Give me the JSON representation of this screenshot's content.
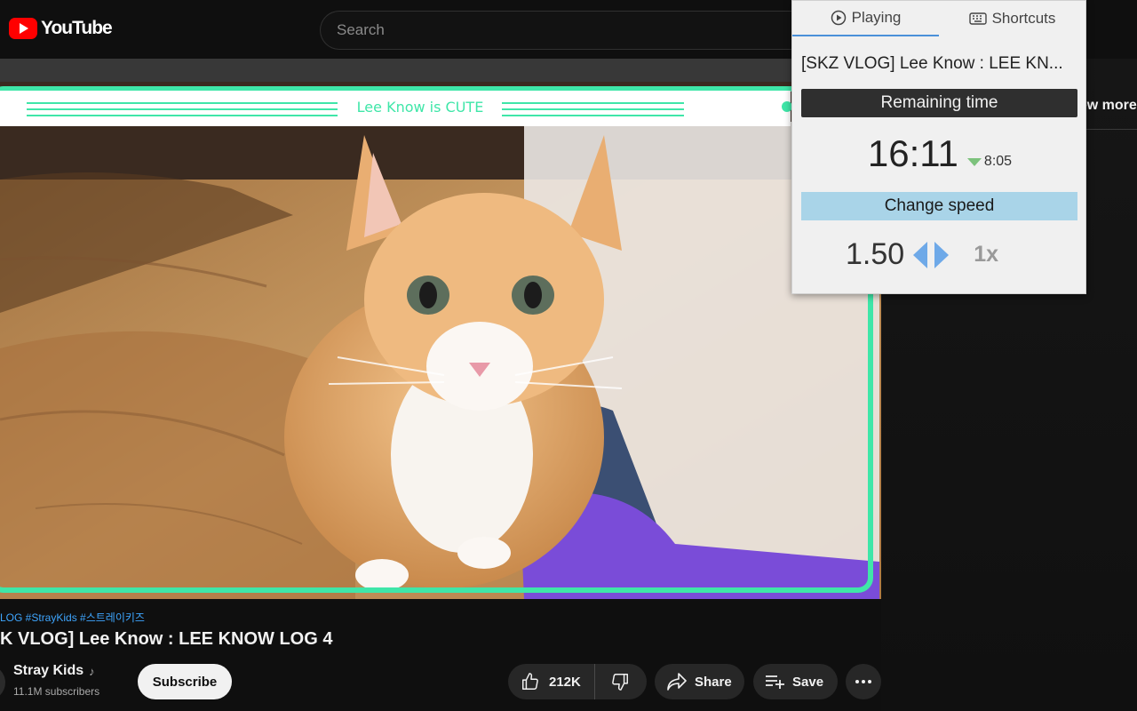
{
  "header": {
    "logo_text": "YouTube",
    "search_placeholder": "Search"
  },
  "video": {
    "overlay_caption": "Lee Know is CUTE"
  },
  "below_video": {
    "hashtags": "LOG #StrayKids #스트레이키즈",
    "title": "K VLOG] Lee Know : LEE KNOW LOG 4",
    "channel_name": "Stray Kids",
    "subscribers": "11.1M subscribers",
    "subscribe_label": "Subscribe",
    "like_count": "212K",
    "share_label": "Share",
    "save_label": "Save"
  },
  "sidebar": {
    "show_more": "ow more"
  },
  "popup": {
    "tabs": [
      {
        "label": "Playing",
        "icon": "play-circle-icon",
        "active": true
      },
      {
        "label": "Shortcuts",
        "icon": "keyboard-icon",
        "active": false
      }
    ],
    "video_title": "[SKZ VLOG] Lee Know : LEE KN...",
    "remaining_label": "Remaining time",
    "remaining_time": "16:11",
    "adjusted_time": "8:05",
    "change_speed_label": "Change speed",
    "speed_value": "1.50",
    "reset_label": "1x"
  },
  "colors": {
    "youtube_red": "#ff0000",
    "link_blue": "#3ea6ff",
    "speed_bar": "#a9d4e8",
    "speed_arrows": "#6ea9e8",
    "time_down_arrow": "#7cc27c",
    "overlay_green": "#3fe6a8"
  }
}
